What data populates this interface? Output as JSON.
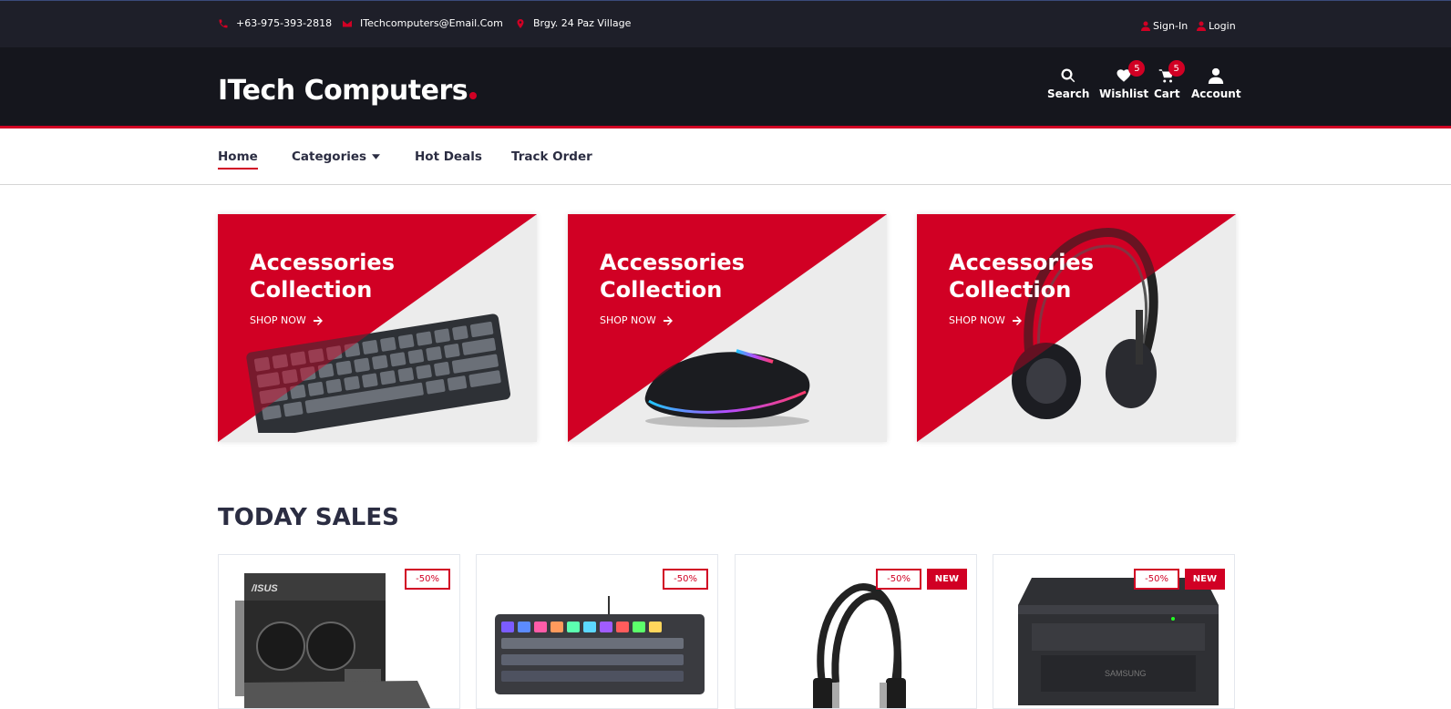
{
  "topbar": {
    "phone": "+63-975-393-2818",
    "email": "ITechcomputers@Email.Com",
    "address": "Brgy. 24 Paz Village",
    "sign_in": "Sign-In",
    "login": "Login"
  },
  "header": {
    "logo": "ITech Computers",
    "icons": {
      "search": "Search",
      "wishlist": "Wishlist",
      "wishlist_count": "5",
      "cart": "Cart",
      "cart_count": "5",
      "account": "Account"
    }
  },
  "nav": {
    "items": [
      {
        "label": "Home"
      },
      {
        "label": "Categories"
      },
      {
        "label": "Hot Deals"
      },
      {
        "label": "Track Order"
      }
    ]
  },
  "collections": [
    {
      "title": "Accessories Collection",
      "cta": "SHOP NOW",
      "product": "keyboard"
    },
    {
      "title": "Accessories Collection",
      "cta": "SHOP NOW",
      "product": "mouse"
    },
    {
      "title": "Accessories Collection",
      "cta": "SHOP NOW",
      "product": "headphones"
    }
  ],
  "today_sales": {
    "title": "TODAY SALES",
    "products": [
      {
        "discount": "-50%",
        "new": "",
        "product": "graphics-card"
      },
      {
        "discount": "-50%",
        "new": "",
        "product": "keyboard"
      },
      {
        "discount": "-50%",
        "new": "NEW",
        "product": "headphones"
      },
      {
        "discount": "-50%",
        "new": "NEW",
        "product": "printer"
      }
    ]
  },
  "colors": {
    "accent": "#d10024",
    "dark": "#15161d",
    "topbar": "#1e1f29"
  }
}
